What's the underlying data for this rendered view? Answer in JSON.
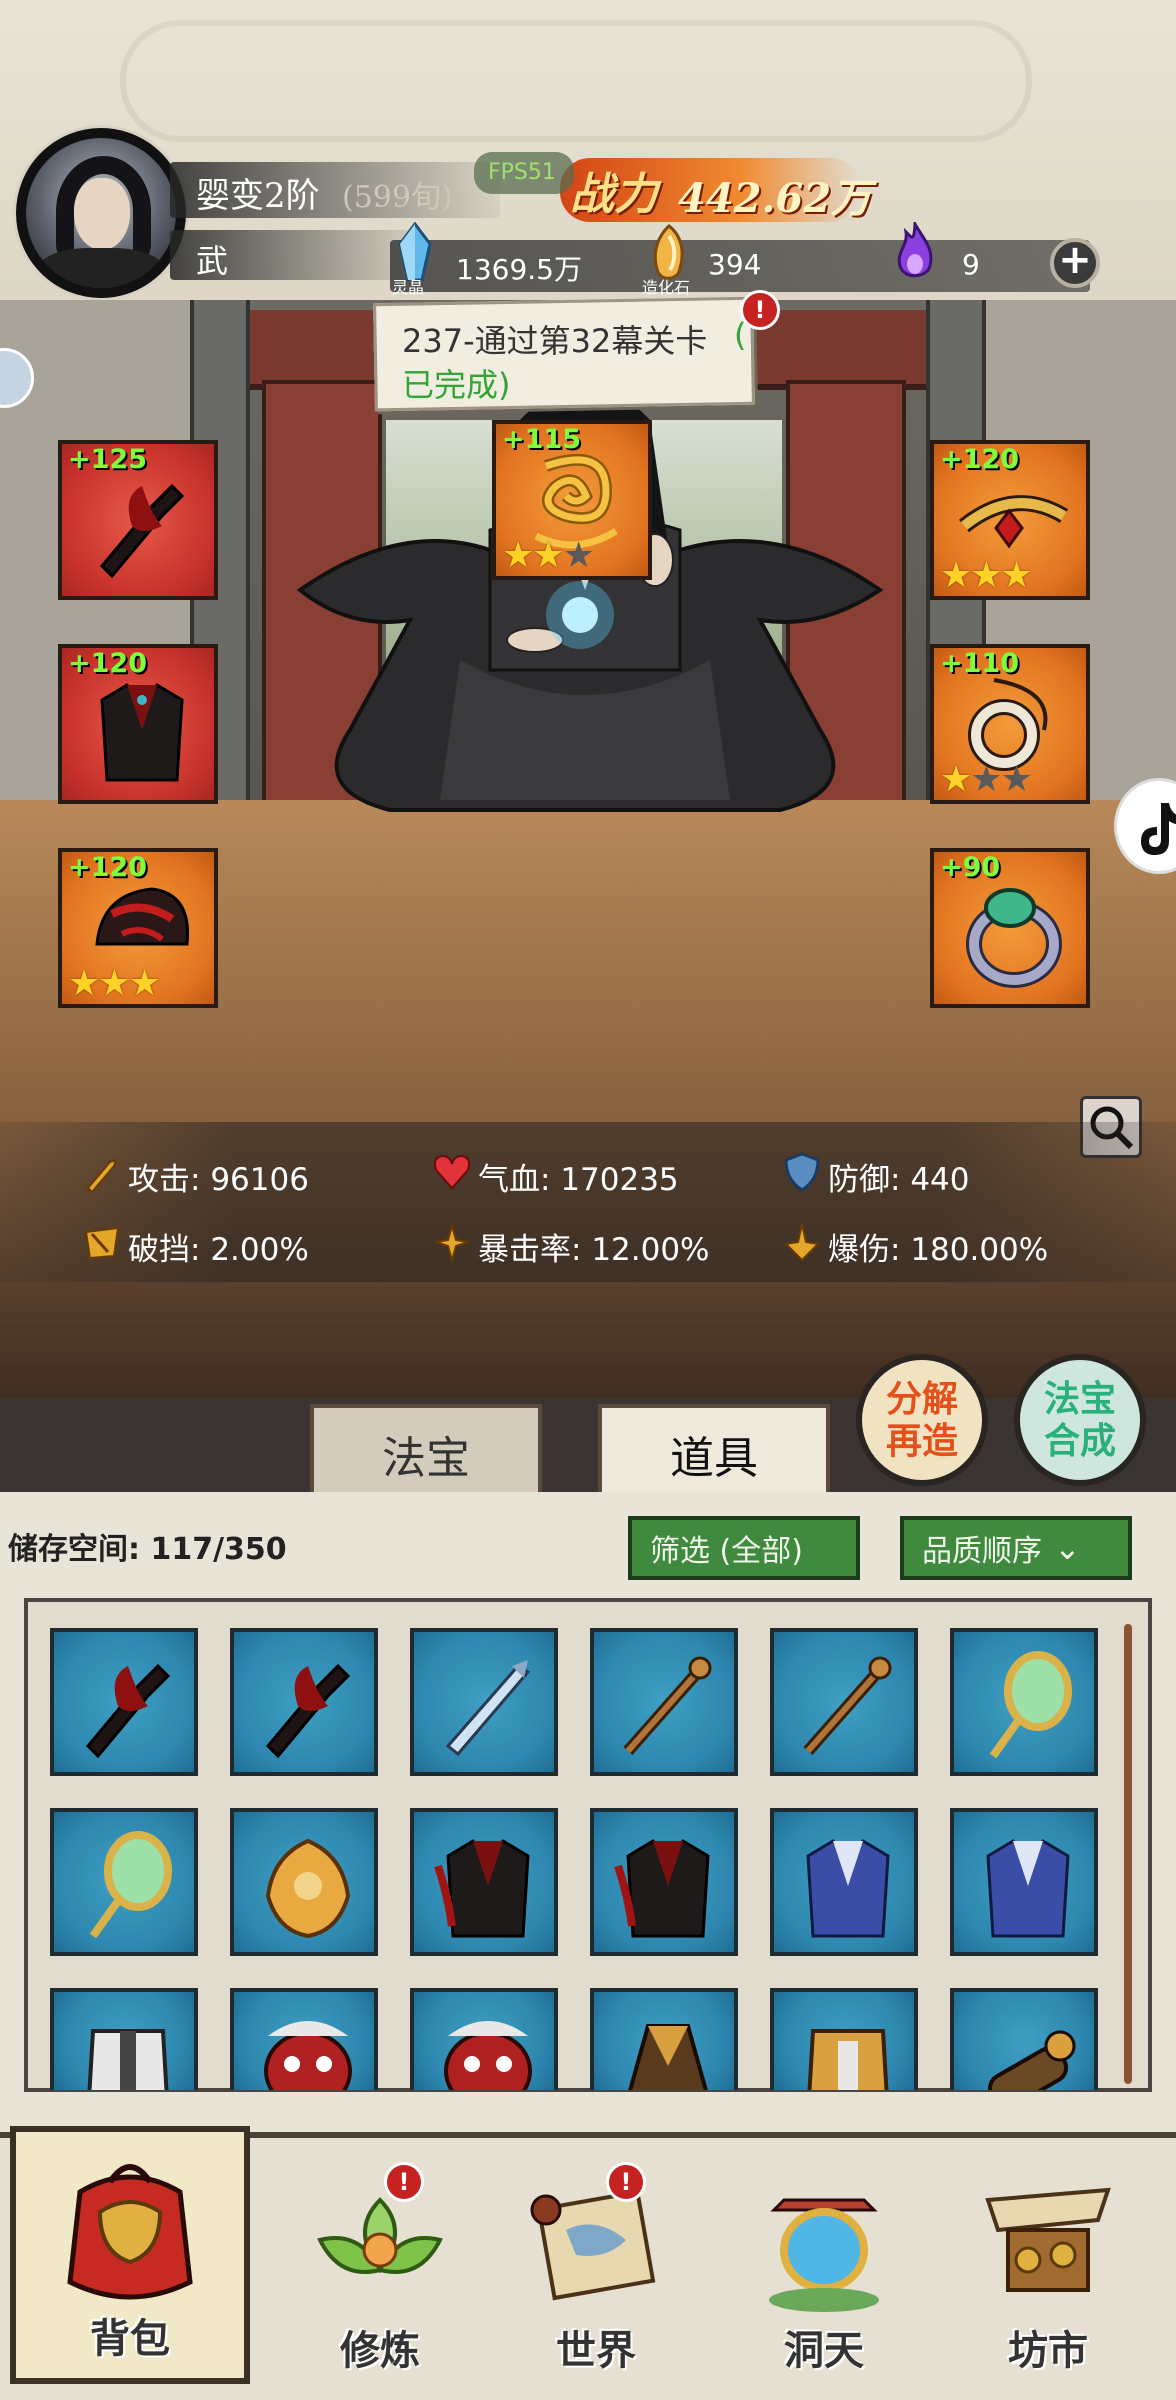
{
  "player": {
    "rank": "婴变2阶",
    "age": "(599旬)",
    "class": "武",
    "fps": "FPS51",
    "power_label": "战力",
    "power_value": "442.62万"
  },
  "resources": [
    {
      "label": "灵晶",
      "value": "1369.5万",
      "icon": "spirit-crystal-icon"
    },
    {
      "label": "造化石",
      "value": "394",
      "icon": "creation-stone-icon"
    },
    {
      "label": "",
      "value": "9",
      "icon": "purple-flame-icon"
    }
  ],
  "quest": {
    "line1": "237-通过第32幕关卡",
    "paren": "(",
    "line2": "已完成)",
    "alert": "!"
  },
  "equipment": {
    "left": [
      {
        "level": "+125",
        "stars": 0,
        "item": "dark-blade"
      },
      {
        "level": "+120",
        "stars": 0,
        "item": "dark-robe"
      },
      {
        "level": "+120",
        "stars": 3,
        "item": "dark-helmet"
      }
    ],
    "center": {
      "level": "+115",
      "stars": 2,
      "item": "golden-dragon"
    },
    "right": [
      {
        "level": "+120",
        "stars": 3,
        "item": "gold-headband"
      },
      {
        "level": "+110",
        "stars": 1,
        "item": "jade-pendant"
      },
      {
        "level": "+90",
        "stars": 0,
        "item": "jade-ring"
      }
    ]
  },
  "stats": [
    {
      "label": "攻击:",
      "value": "96106",
      "icon": "sword-icon"
    },
    {
      "label": "气血:",
      "value": "170235",
      "icon": "heart-icon"
    },
    {
      "label": "防御:",
      "value": "440",
      "icon": "shield-icon"
    },
    {
      "label": "破挡:",
      "value": "2.00%",
      "icon": "break-icon"
    },
    {
      "label": "暴击率:",
      "value": "12.00%",
      "icon": "crit-icon"
    },
    {
      "label": "爆伤:",
      "value": "180.00%",
      "icon": "crit-damage-icon"
    }
  ],
  "actions": {
    "decompose": [
      "分解",
      "再造"
    ],
    "synthesize": [
      "法宝",
      "合成"
    ]
  },
  "tabs": [
    "法宝",
    "道具"
  ],
  "inventory": {
    "storage_label": "储存空间:",
    "storage_value": "117/350",
    "filter": "筛选 (全部)",
    "sort": "品质顺序",
    "items": [
      "dark-blade",
      "dark-blade",
      "ice-sword",
      "bronze-staff",
      "bronze-staff",
      "jade-mirror",
      "jade-mirror",
      "golden-flower-armor",
      "dark-robe",
      "dark-robe",
      "blue-robe",
      "blue-robe",
      "white-armor",
      "red-demon-mask",
      "red-demon-mask",
      "brown-cloak",
      "golden-armor",
      "bronze-cannon"
    ]
  },
  "nav": [
    {
      "label": "背包",
      "badge": ""
    },
    {
      "label": "修炼",
      "badge": "!"
    },
    {
      "label": "世界",
      "badge": "!"
    },
    {
      "label": "洞天",
      "badge": ""
    },
    {
      "label": "坊市",
      "badge": ""
    }
  ],
  "colors": {
    "slot_red": "#c8322c",
    "slot_orange": "#e27420",
    "cell_blue": "#2d86ae",
    "level_green": "#7dff3c",
    "button_green": "#3f8a3e",
    "power_orange": "#f08a30"
  }
}
